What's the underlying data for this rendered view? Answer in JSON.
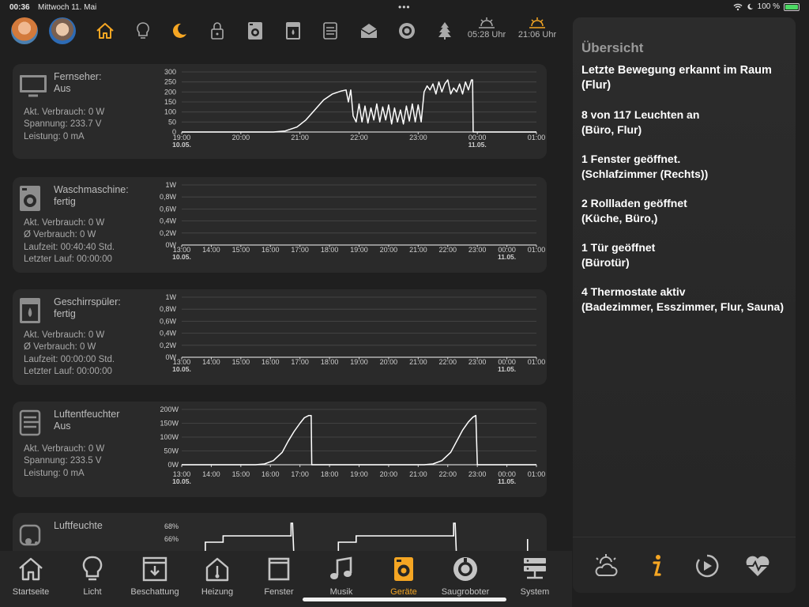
{
  "status": {
    "time": "00:36",
    "date": "Mittwoch 11. Mai",
    "battery": "100 %"
  },
  "sun": {
    "sunrise": "05:28 Uhr",
    "sunset": "21:06 Uhr"
  },
  "colors": {
    "accent": "#f5a623",
    "card": "#2a2a2a",
    "panel": "#282828"
  },
  "devices": [
    {
      "name": "Fernseher:",
      "state": "Aus",
      "stats": [
        "Akt. Verbrauch: 0 W",
        "Spannung: 233.7 V",
        "Leistung: 0 mA"
      ],
      "chart_data": {
        "type": "line",
        "y_ticks": [
          "300",
          "250",
          "200",
          "150",
          "100",
          "50",
          "0"
        ],
        "y_max": 300,
        "x_ticks": [
          [
            "19:00",
            "10.05."
          ],
          [
            "20:00",
            ""
          ],
          [
            "21:00",
            ""
          ],
          [
            "22:00",
            ""
          ],
          [
            "23:00",
            ""
          ],
          [
            "00:00",
            "11.05."
          ],
          [
            "01:00",
            ""
          ]
        ],
        "x_range": [
          0,
          6
        ],
        "points": [
          [
            0,
            0
          ],
          [
            1.55,
            0
          ],
          [
            1.75,
            5
          ],
          [
            1.95,
            25
          ],
          [
            2.1,
            60
          ],
          [
            2.25,
            110
          ],
          [
            2.4,
            160
          ],
          [
            2.55,
            190
          ],
          [
            2.7,
            205
          ],
          [
            2.78,
            210
          ],
          [
            2.82,
            150
          ],
          [
            2.86,
            210
          ],
          [
            2.9,
            80
          ],
          [
            2.95,
            50
          ],
          [
            3.0,
            140
          ],
          [
            3.05,
            50
          ],
          [
            3.1,
            130
          ],
          [
            3.15,
            45
          ],
          [
            3.2,
            120
          ],
          [
            3.25,
            60
          ],
          [
            3.3,
            140
          ],
          [
            3.35,
            50
          ],
          [
            3.4,
            125
          ],
          [
            3.45,
            60
          ],
          [
            3.5,
            135
          ],
          [
            3.55,
            40
          ],
          [
            3.6,
            120
          ],
          [
            3.65,
            50
          ],
          [
            3.7,
            110
          ],
          [
            3.75,
            40
          ],
          [
            3.8,
            130
          ],
          [
            3.85,
            55
          ],
          [
            3.9,
            140
          ],
          [
            3.95,
            50
          ],
          [
            4.0,
            135
          ],
          [
            4.05,
            50
          ],
          [
            4.1,
            200
          ],
          [
            4.15,
            230
          ],
          [
            4.2,
            210
          ],
          [
            4.25,
            240
          ],
          [
            4.3,
            190
          ],
          [
            4.35,
            250
          ],
          [
            4.4,
            200
          ],
          [
            4.45,
            240
          ],
          [
            4.5,
            260
          ],
          [
            4.55,
            190
          ],
          [
            4.6,
            220
          ],
          [
            4.65,
            200
          ],
          [
            4.7,
            240
          ],
          [
            4.75,
            190
          ],
          [
            4.8,
            250
          ],
          [
            4.85,
            210
          ],
          [
            4.9,
            260
          ],
          [
            4.92,
            260
          ],
          [
            4.93,
            0
          ],
          [
            6,
            0
          ]
        ]
      }
    },
    {
      "name": "Waschmaschine:",
      "state": "fertig",
      "stats": [
        "Akt. Verbrauch: 0 W",
        "Ø Verbrauch: 0 W",
        "Laufzeit: 00:40:40 Std.",
        "Letzter Lauf: 00:00:00"
      ],
      "chart_data": {
        "type": "line",
        "y_ticks": [
          "1W",
          "0,8W",
          "0,6W",
          "0,4W",
          "0,2W",
          "0W"
        ],
        "y_max": 1,
        "x_ticks": [
          [
            "13:00",
            "10.05."
          ],
          [
            "14:00",
            ""
          ],
          [
            "15:00",
            ""
          ],
          [
            "16:00",
            ""
          ],
          [
            "17:00",
            ""
          ],
          [
            "18:00",
            ""
          ],
          [
            "19:00",
            ""
          ],
          [
            "20:00",
            ""
          ],
          [
            "21:00",
            ""
          ],
          [
            "22:00",
            ""
          ],
          [
            "23:00",
            ""
          ],
          [
            "00:00",
            "11.05."
          ],
          [
            "01:00",
            ""
          ]
        ],
        "x_range": [
          0,
          12
        ],
        "points": [
          [
            0,
            0
          ],
          [
            12,
            0
          ]
        ]
      }
    },
    {
      "name": "Geschirrspüler:",
      "state": "fertig",
      "stats": [
        "Akt. Verbrauch: 0 W",
        "Ø Verbrauch: 0 W",
        "Laufzeit: 00:00:00 Std.",
        "Letzter Lauf: 00:00:00"
      ],
      "chart_data": {
        "type": "line",
        "y_ticks": [
          "1W",
          "0,8W",
          "0,6W",
          "0,4W",
          "0,2W",
          "0W"
        ],
        "y_max": 1,
        "x_ticks": [
          [
            "13:00",
            "10.05."
          ],
          [
            "14:00",
            ""
          ],
          [
            "15:00",
            ""
          ],
          [
            "16:00",
            ""
          ],
          [
            "17:00",
            ""
          ],
          [
            "18:00",
            ""
          ],
          [
            "19:00",
            ""
          ],
          [
            "20:00",
            ""
          ],
          [
            "21:00",
            ""
          ],
          [
            "22:00",
            ""
          ],
          [
            "23:00",
            ""
          ],
          [
            "00:00",
            "11.05."
          ],
          [
            "01:00",
            ""
          ]
        ],
        "x_range": [
          0,
          12
        ],
        "points": [
          [
            0,
            0
          ],
          [
            12,
            0
          ]
        ]
      }
    },
    {
      "name": "Luftentfeuchter",
      "state": "Aus",
      "stats": [
        "Akt. Verbrauch: 0 W",
        "Spannung: 233.5 V",
        "Leistung: 0 mA"
      ],
      "chart_data": {
        "type": "line",
        "y_ticks": [
          "200W",
          "150W",
          "100W",
          "50W",
          "0W"
        ],
        "y_max": 200,
        "x_ticks": [
          [
            "13:00",
            "10.05."
          ],
          [
            "14:00",
            ""
          ],
          [
            "15:00",
            ""
          ],
          [
            "16:00",
            ""
          ],
          [
            "17:00",
            ""
          ],
          [
            "18:00",
            ""
          ],
          [
            "19:00",
            ""
          ],
          [
            "20:00",
            ""
          ],
          [
            "21:00",
            ""
          ],
          [
            "22:00",
            ""
          ],
          [
            "23:00",
            ""
          ],
          [
            "00:00",
            "11.05."
          ],
          [
            "01:00",
            ""
          ]
        ],
        "x_range": [
          0,
          12
        ],
        "points": [
          [
            0,
            0
          ],
          [
            2.5,
            0
          ],
          [
            2.8,
            3
          ],
          [
            3.1,
            15
          ],
          [
            3.4,
            45
          ],
          [
            3.6,
            85
          ],
          [
            3.8,
            120
          ],
          [
            4.0,
            150
          ],
          [
            4.15,
            170
          ],
          [
            4.3,
            178
          ],
          [
            4.38,
            178
          ],
          [
            4.4,
            0
          ],
          [
            8.2,
            0
          ],
          [
            8.5,
            3
          ],
          [
            8.8,
            15
          ],
          [
            9.1,
            45
          ],
          [
            9.3,
            85
          ],
          [
            9.5,
            125
          ],
          [
            9.7,
            155
          ],
          [
            9.85,
            172
          ],
          [
            9.95,
            178
          ],
          [
            10.0,
            0
          ],
          [
            12,
            0
          ]
        ]
      }
    },
    {
      "name": "Luftfeuchte",
      "state": "",
      "stats": [],
      "chart_data": {
        "type": "line",
        "y_ticks": [
          "68%",
          "66%"
        ],
        "y_max": 68,
        "y_min": 60,
        "x_ticks": [],
        "x_range": [
          0,
          12
        ],
        "points": [
          [
            0.8,
            60
          ],
          [
            0.8,
            65.5
          ],
          [
            1.4,
            65.5
          ],
          [
            1.4,
            66.5
          ],
          [
            3.7,
            66.5
          ],
          [
            3.7,
            68.5
          ],
          [
            3.75,
            68.5
          ],
          [
            3.8,
            60
          ]
        ],
        "points2": [
          [
            5.3,
            60
          ],
          [
            5.3,
            65.5
          ],
          [
            5.9,
            65.5
          ],
          [
            5.9,
            66.5
          ],
          [
            9.2,
            66.5
          ],
          [
            9.2,
            68.5
          ],
          [
            9.25,
            68.5
          ],
          [
            9.3,
            60
          ]
        ]
      }
    }
  ],
  "overview": {
    "title": "Übersicht",
    "items": [
      {
        "line1": "Letzte Bewegung erkannt im Raum",
        "line2": "(Flur)"
      },
      {
        "line1": "8 von 117 Leuchten an",
        "line2": "(Büro, Flur)"
      },
      {
        "line1": "1 Fenster geöffnet.",
        "line2": "(Schlafzimmer (Rechts))"
      },
      {
        "line1": "2 Rollladen geöffnet",
        "line2": "(Küche, Büro,)"
      },
      {
        "line1": "1 Tür geöffnet",
        "line2": "(Bürotür)"
      },
      {
        "line1": "4 Thermostate aktiv",
        "line2": "(Badezimmer, Esszimmer, Flur, Sauna)"
      }
    ]
  },
  "tabs": [
    {
      "label": "Startseite",
      "icon": "home-icon"
    },
    {
      "label": "Licht",
      "icon": "bulb-icon"
    },
    {
      "label": "Beschattung",
      "icon": "shutter-icon"
    },
    {
      "label": "Heizung",
      "icon": "heating-icon"
    },
    {
      "label": "Fenster",
      "icon": "window-icon"
    },
    {
      "label": "Musik",
      "icon": "music-icon"
    },
    {
      "label": "Geräte",
      "icon": "washer-icon",
      "active": true
    },
    {
      "label": "Saugroboter",
      "icon": "robot-vacuum-icon"
    },
    {
      "label": "System",
      "icon": "server-icon"
    }
  ]
}
